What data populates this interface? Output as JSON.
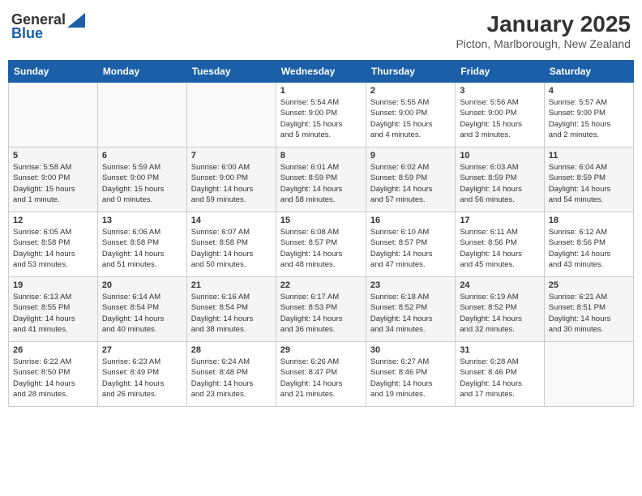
{
  "header": {
    "logo_general": "General",
    "logo_blue": "Blue",
    "month_title": "January 2025",
    "location": "Picton, Marlborough, New Zealand"
  },
  "days_of_week": [
    "Sunday",
    "Monday",
    "Tuesday",
    "Wednesday",
    "Thursday",
    "Friday",
    "Saturday"
  ],
  "weeks": [
    [
      {
        "day": "",
        "info": ""
      },
      {
        "day": "",
        "info": ""
      },
      {
        "day": "",
        "info": ""
      },
      {
        "day": "1",
        "info": "Sunrise: 5:54 AM\nSunset: 9:00 PM\nDaylight: 15 hours\nand 5 minutes."
      },
      {
        "day": "2",
        "info": "Sunrise: 5:55 AM\nSunset: 9:00 PM\nDaylight: 15 hours\nand 4 minutes."
      },
      {
        "day": "3",
        "info": "Sunrise: 5:56 AM\nSunset: 9:00 PM\nDaylight: 15 hours\nand 3 minutes."
      },
      {
        "day": "4",
        "info": "Sunrise: 5:57 AM\nSunset: 9:00 PM\nDaylight: 15 hours\nand 2 minutes."
      }
    ],
    [
      {
        "day": "5",
        "info": "Sunrise: 5:58 AM\nSunset: 9:00 PM\nDaylight: 15 hours\nand 1 minute."
      },
      {
        "day": "6",
        "info": "Sunrise: 5:59 AM\nSunset: 9:00 PM\nDaylight: 15 hours\nand 0 minutes."
      },
      {
        "day": "7",
        "info": "Sunrise: 6:00 AM\nSunset: 9:00 PM\nDaylight: 14 hours\nand 59 minutes."
      },
      {
        "day": "8",
        "info": "Sunrise: 6:01 AM\nSunset: 8:59 PM\nDaylight: 14 hours\nand 58 minutes."
      },
      {
        "day": "9",
        "info": "Sunrise: 6:02 AM\nSunset: 8:59 PM\nDaylight: 14 hours\nand 57 minutes."
      },
      {
        "day": "10",
        "info": "Sunrise: 6:03 AM\nSunset: 8:59 PM\nDaylight: 14 hours\nand 56 minutes."
      },
      {
        "day": "11",
        "info": "Sunrise: 6:04 AM\nSunset: 8:59 PM\nDaylight: 14 hours\nand 54 minutes."
      }
    ],
    [
      {
        "day": "12",
        "info": "Sunrise: 6:05 AM\nSunset: 8:58 PM\nDaylight: 14 hours\nand 53 minutes."
      },
      {
        "day": "13",
        "info": "Sunrise: 6:06 AM\nSunset: 8:58 PM\nDaylight: 14 hours\nand 51 minutes."
      },
      {
        "day": "14",
        "info": "Sunrise: 6:07 AM\nSunset: 8:58 PM\nDaylight: 14 hours\nand 50 minutes."
      },
      {
        "day": "15",
        "info": "Sunrise: 6:08 AM\nSunset: 8:57 PM\nDaylight: 14 hours\nand 48 minutes."
      },
      {
        "day": "16",
        "info": "Sunrise: 6:10 AM\nSunset: 8:57 PM\nDaylight: 14 hours\nand 47 minutes."
      },
      {
        "day": "17",
        "info": "Sunrise: 6:11 AM\nSunset: 8:56 PM\nDaylight: 14 hours\nand 45 minutes."
      },
      {
        "day": "18",
        "info": "Sunrise: 6:12 AM\nSunset: 8:56 PM\nDaylight: 14 hours\nand 43 minutes."
      }
    ],
    [
      {
        "day": "19",
        "info": "Sunrise: 6:13 AM\nSunset: 8:55 PM\nDaylight: 14 hours\nand 41 minutes."
      },
      {
        "day": "20",
        "info": "Sunrise: 6:14 AM\nSunset: 8:54 PM\nDaylight: 14 hours\nand 40 minutes."
      },
      {
        "day": "21",
        "info": "Sunrise: 6:16 AM\nSunset: 8:54 PM\nDaylight: 14 hours\nand 38 minutes."
      },
      {
        "day": "22",
        "info": "Sunrise: 6:17 AM\nSunset: 8:53 PM\nDaylight: 14 hours\nand 36 minutes."
      },
      {
        "day": "23",
        "info": "Sunrise: 6:18 AM\nSunset: 8:52 PM\nDaylight: 14 hours\nand 34 minutes."
      },
      {
        "day": "24",
        "info": "Sunrise: 6:19 AM\nSunset: 8:52 PM\nDaylight: 14 hours\nand 32 minutes."
      },
      {
        "day": "25",
        "info": "Sunrise: 6:21 AM\nSunset: 8:51 PM\nDaylight: 14 hours\nand 30 minutes."
      }
    ],
    [
      {
        "day": "26",
        "info": "Sunrise: 6:22 AM\nSunset: 8:50 PM\nDaylight: 14 hours\nand 28 minutes."
      },
      {
        "day": "27",
        "info": "Sunrise: 6:23 AM\nSunset: 8:49 PM\nDaylight: 14 hours\nand 26 minutes."
      },
      {
        "day": "28",
        "info": "Sunrise: 6:24 AM\nSunset: 8:48 PM\nDaylight: 14 hours\nand 23 minutes."
      },
      {
        "day": "29",
        "info": "Sunrise: 6:26 AM\nSunset: 8:47 PM\nDaylight: 14 hours\nand 21 minutes."
      },
      {
        "day": "30",
        "info": "Sunrise: 6:27 AM\nSunset: 8:46 PM\nDaylight: 14 hours\nand 19 minutes."
      },
      {
        "day": "31",
        "info": "Sunrise: 6:28 AM\nSunset: 8:46 PM\nDaylight: 14 hours\nand 17 minutes."
      },
      {
        "day": "",
        "info": ""
      }
    ]
  ]
}
